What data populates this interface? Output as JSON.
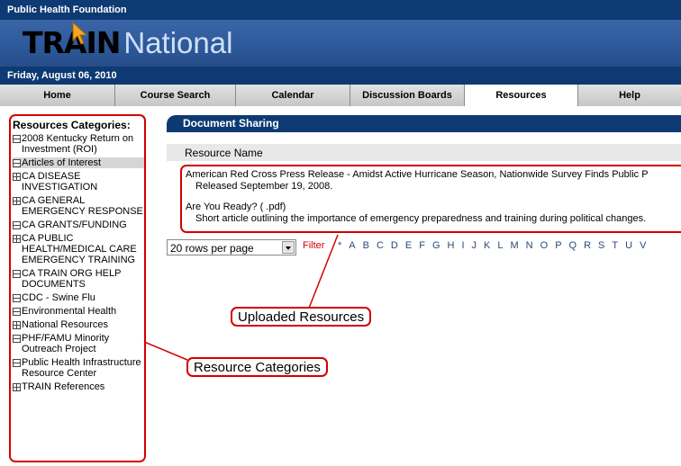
{
  "header": {
    "org_name": "Public Health Foundation",
    "logo_bold": "TRAIN",
    "logo_light": "National",
    "date": "Friday, August 06, 2010"
  },
  "nav": {
    "tabs": [
      {
        "label": "Home"
      },
      {
        "label": "Course Search"
      },
      {
        "label": "Calendar"
      },
      {
        "label": "Discussion Boards"
      },
      {
        "label": "Resources"
      },
      {
        "label": "Help"
      }
    ]
  },
  "sidebar": {
    "title": "Resources Categories:",
    "items": [
      {
        "label": "2008 Kentucky Return on Investment (ROI)",
        "icon": "collapse-icon"
      },
      {
        "label": "Articles of Interest",
        "icon": "collapse-icon"
      },
      {
        "label": "CA DISEASE INVESTIGATION",
        "icon": "expand-grid-icon"
      },
      {
        "label": "CA GENERAL EMERGENCY RESPONSE",
        "icon": "expand-grid-icon"
      },
      {
        "label": "CA GRANTS/FUNDING",
        "icon": "collapse-icon"
      },
      {
        "label": "CA PUBLIC HEALTH/MEDICAL CARE EMERGENCY TRAINING",
        "icon": "expand-grid-icon"
      },
      {
        "label": "CA TRAIN ORG HELP DOCUMENTS",
        "icon": "collapse-icon"
      },
      {
        "label": "CDC - Swine Flu",
        "icon": "collapse-icon"
      },
      {
        "label": "Environmental Health",
        "icon": "collapse-icon"
      },
      {
        "label": "National Resources",
        "icon": "expand-grid-icon"
      },
      {
        "label": "PHF/FAMU Minority Outreach Project",
        "icon": "collapse-icon"
      },
      {
        "label": "Public Health Infrastructure Resource Center",
        "icon": "collapse-icon"
      },
      {
        "label": "TRAIN References",
        "icon": "expand-grid-icon"
      }
    ],
    "selected_index": 1
  },
  "main": {
    "section_title": "Document Sharing",
    "column_header": "Resource Name",
    "resources": [
      {
        "title": "American Red Cross Press Release - Amidst Active Hurricane Season, Nationwide Survey Finds Public P",
        "description": "Released September 19, 2008."
      },
      {
        "title": "Are You Ready?  ( .pdf)",
        "description": "Short article outlining the importance of emergency preparedness and training during political changes."
      }
    ],
    "rows_per_page": "20 rows per page",
    "filter_label": "Filter",
    "letters": [
      "*",
      "A",
      "B",
      "C",
      "D",
      "E",
      "F",
      "G",
      "H",
      "I",
      "J",
      "K",
      "L",
      "M",
      "N",
      "O",
      "P",
      "Q",
      "R",
      "S",
      "T",
      "U",
      "V"
    ]
  },
  "annotations": {
    "uploaded_resources": "Uploaded Resources",
    "resource_categories": "Resource Categories"
  },
  "colors": {
    "header_blue": "#0d3a72",
    "banner_blue": "#2d5899",
    "callout_red": "#d40000",
    "tab_gray": "#cfcfcf"
  }
}
